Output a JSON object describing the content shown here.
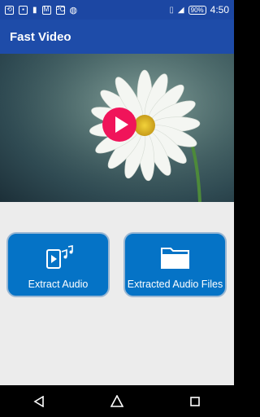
{
  "status_bar": {
    "notification_icons": [
      "fast-video-icon",
      "image-icon",
      "bookmark-icon",
      "gmail-icon",
      "pc-icon",
      "basketball-icon"
    ],
    "battery_percent": "90%",
    "time": "4:50"
  },
  "app_bar": {
    "title": "Fast Video"
  },
  "hero": {
    "image": "daisy-flower",
    "play_button_color": "#f0145a"
  },
  "actions": {
    "extract_audio_label": "Extract Audio",
    "extracted_files_label": "Extracted Audio Files"
  },
  "nav": {
    "back": "back-icon",
    "home": "home-icon",
    "recents": "recents-icon"
  },
  "colors": {
    "primary": "#1e4ca9",
    "button": "#0573c6",
    "button_border": "#9ab7d3",
    "accent": "#f0145a"
  }
}
